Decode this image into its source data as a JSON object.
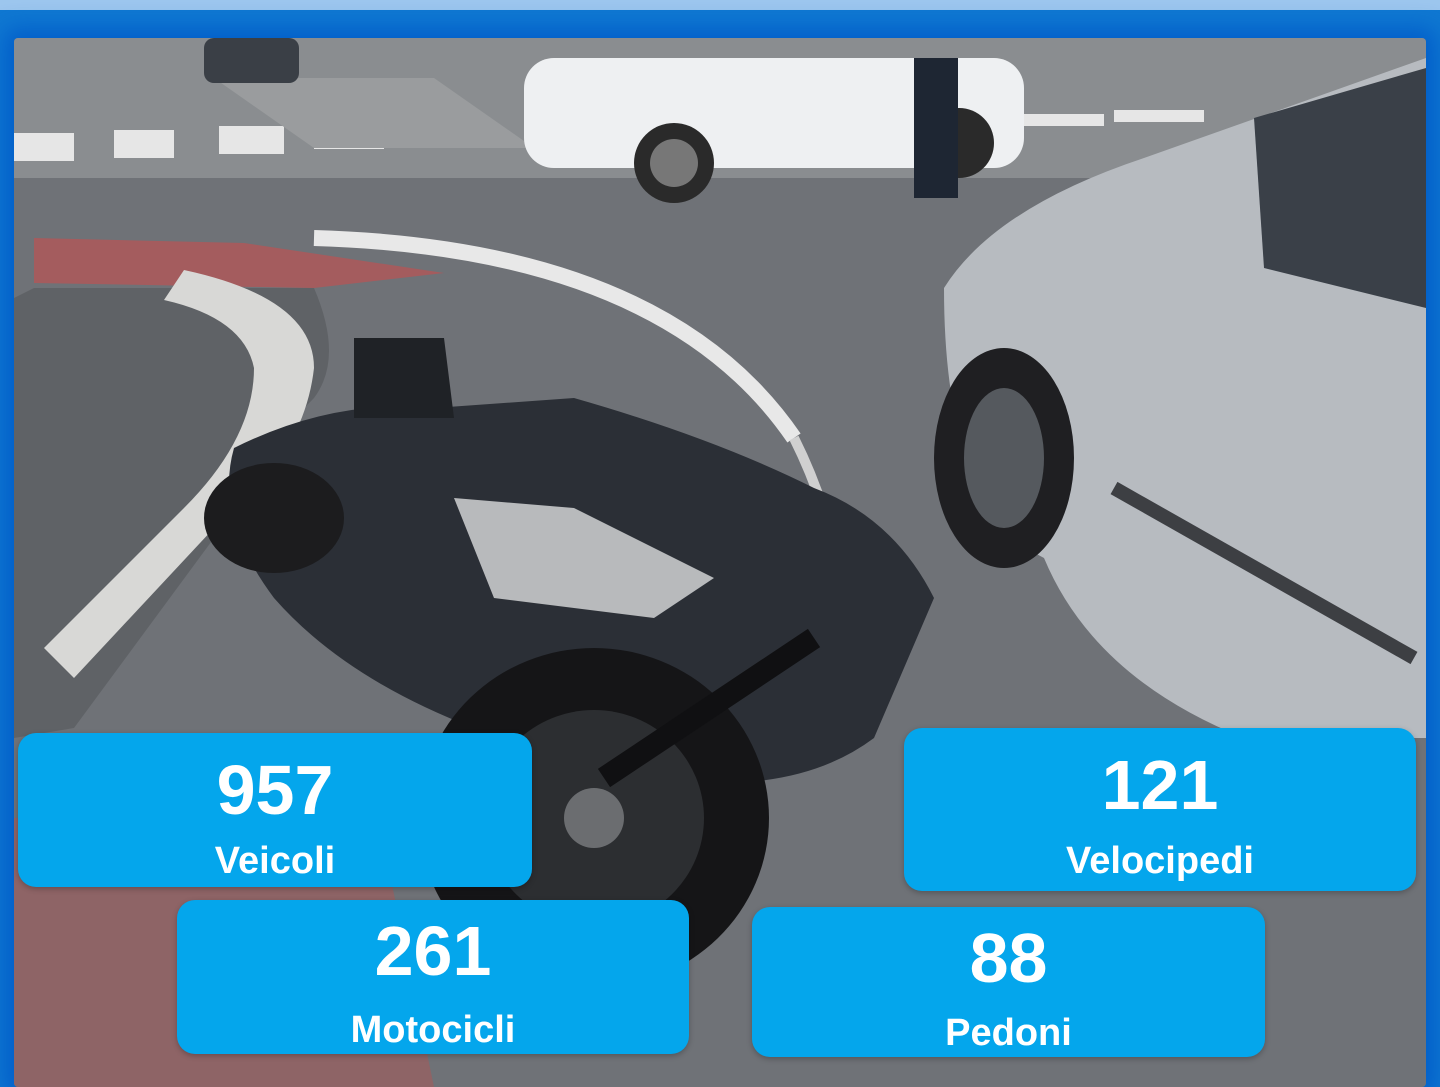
{
  "stats": [
    {
      "value": "957",
      "label": "Veicoli"
    },
    {
      "value": "121",
      "label": "Velocipedi"
    },
    {
      "value": "261",
      "label": "Motocicli"
    },
    {
      "value": "88",
      "label": "Pedoni"
    }
  ],
  "colors": {
    "frame": "#0f78d2",
    "card": "#04a6ec",
    "text": "#ffffff"
  }
}
